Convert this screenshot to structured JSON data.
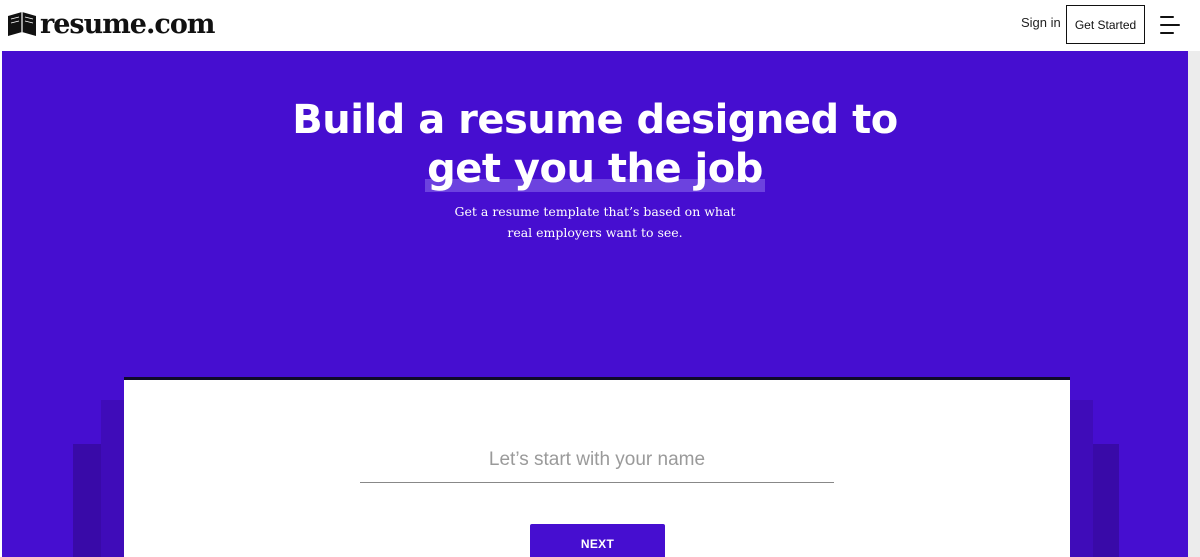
{
  "header": {
    "logo_text": "resume.com",
    "signin_label": "Sign in",
    "get_started_label": "Get Started",
    "menu_icon": "hamburger-menu-icon"
  },
  "hero": {
    "title_line1": "Build a resume designed to",
    "title_line2": "get you the job",
    "subtitle": "Get a resume template that’s based on what real employers want to see.",
    "background_color": "#460ed0"
  },
  "form": {
    "name_placeholder": "Let’s start with your name",
    "name_value": "",
    "next_label": "NEXT"
  }
}
